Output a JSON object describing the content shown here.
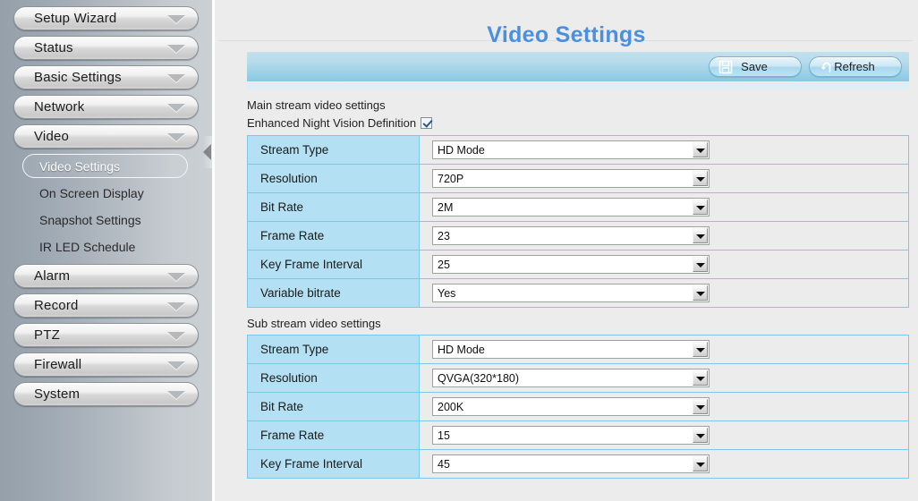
{
  "sidebar": {
    "items": [
      {
        "label": "Setup Wizard",
        "icon": "chevron-down-icon"
      },
      {
        "label": "Status",
        "icon": "chevron-down-icon"
      },
      {
        "label": "Basic Settings",
        "icon": "chevron-down-icon"
      },
      {
        "label": "Network",
        "icon": "chevron-down-icon"
      },
      {
        "label": "Video",
        "icon": "chevron-down-icon"
      }
    ],
    "sub_items": [
      {
        "label": "Video Settings",
        "active": true
      },
      {
        "label": "On Screen Display",
        "active": false
      },
      {
        "label": "Snapshot Settings",
        "active": false
      },
      {
        "label": "IR LED Schedule",
        "active": false
      }
    ],
    "items_bottom": [
      {
        "label": "Alarm",
        "icon": "chevron-down-icon"
      },
      {
        "label": "Record",
        "icon": "chevron-down-icon"
      },
      {
        "label": "PTZ",
        "icon": "chevron-down-icon"
      },
      {
        "label": "Firewall",
        "icon": "chevron-down-icon"
      },
      {
        "label": "System",
        "icon": "chevron-down-icon"
      }
    ],
    "collapse_handle_icon": "chevron-left-icon"
  },
  "header": {
    "title": "Video Settings",
    "title_color": "#4a90e2"
  },
  "toolbar": {
    "save_label": "Save",
    "save_icon": "floppy-disk-icon",
    "refresh_label": "Refresh",
    "refresh_icon": "refresh-arrow-icon"
  },
  "main_stream": {
    "section_label": "Main stream video settings",
    "enhanced_night_vision": {
      "label": "Enhanced Night Vision Definition",
      "checked": true
    },
    "rows": [
      {
        "label": "Stream Type",
        "value": "HD Mode"
      },
      {
        "label": "Resolution",
        "value": "720P"
      },
      {
        "label": "Bit Rate",
        "value": "2M"
      },
      {
        "label": "Frame Rate",
        "value": "23"
      },
      {
        "label": "Key Frame Interval",
        "value": "25"
      },
      {
        "label": "Variable bitrate",
        "value": "Yes"
      }
    ]
  },
  "sub_stream": {
    "section_label": "Sub stream video settings",
    "rows": [
      {
        "label": "Stream Type",
        "value": "HD Mode"
      },
      {
        "label": "Resolution",
        "value": "QVGA(320*180)"
      },
      {
        "label": "Bit Rate",
        "value": "200K"
      },
      {
        "label": "Frame Rate",
        "value": "15"
      },
      {
        "label": "Key Frame Interval",
        "value": "45"
      }
    ]
  },
  "colors": {
    "accent": "#4a90e2",
    "table_label_bg": "#b3e0f3",
    "table_border": "#7fc6e8",
    "toolbar_bg": "#9bd0e6"
  }
}
